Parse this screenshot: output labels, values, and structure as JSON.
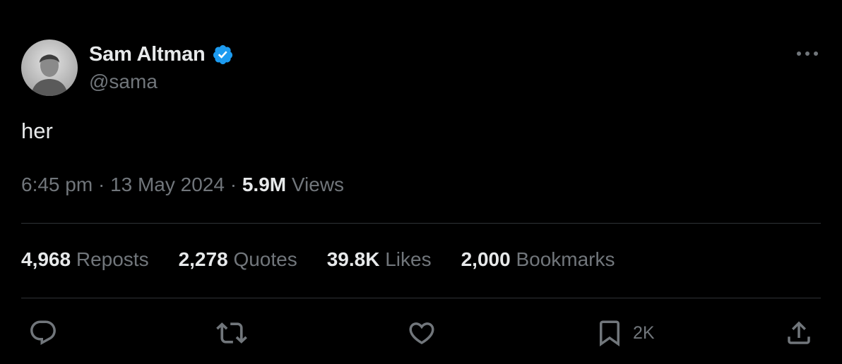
{
  "author": {
    "display_name": "Sam Altman",
    "handle": "@sama",
    "verified": true,
    "verified_color": "#1d9bf0"
  },
  "tweet": {
    "text": "her",
    "time": "6:45 pm",
    "separator": "·",
    "date": "13 May 2024",
    "views_count": "5.9M",
    "views_label": "Views"
  },
  "stats": [
    {
      "count": "4,968",
      "label": "Reposts"
    },
    {
      "count": "2,278",
      "label": "Quotes"
    },
    {
      "count": "39.8K",
      "label": "Likes"
    },
    {
      "count": "2,000",
      "label": "Bookmarks"
    }
  ],
  "actions": {
    "reply_icon": "reply-icon",
    "repost_icon": "repost-icon",
    "like_icon": "heart-icon",
    "bookmark_icon": "bookmark-icon",
    "bookmark_count": "2K",
    "share_icon": "share-icon",
    "more_icon": "more-icon"
  },
  "colors": {
    "background": "#000000",
    "primary_text": "#e7e9ea",
    "secondary_text": "#71767b",
    "divider": "#2f3336"
  }
}
